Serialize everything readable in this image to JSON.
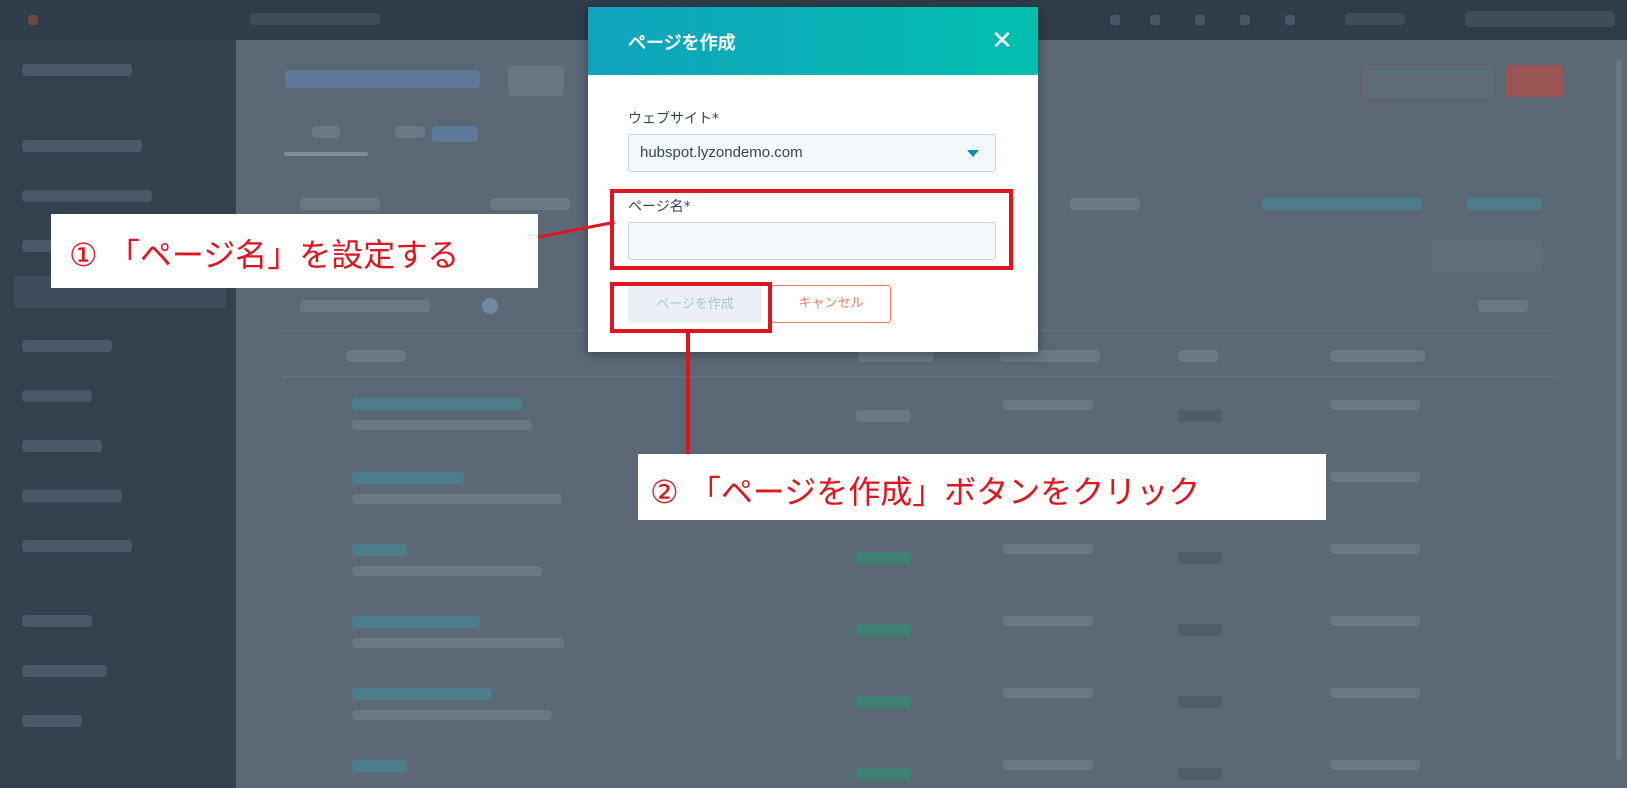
{
  "modal": {
    "title": "ページを作成",
    "close_icon": "close-icon",
    "website_label": "ウェブサイト*",
    "website_value": "hubspot.lyzondemo.com",
    "page_name_label": "ページ名*",
    "page_name_value": "",
    "create_button": "ページを作成",
    "cancel_button": "キャンセル"
  },
  "annotations": {
    "step1": "① 「ページ名」を設定する",
    "step2": "② 「ページを作成」ボタンをクリック"
  },
  "colors": {
    "header_gradient_start": "#0fa3bd",
    "header_gradient_end": "#03bfae",
    "annotation_red": "#e0141e",
    "cancel_orange": "#ff7a59"
  }
}
